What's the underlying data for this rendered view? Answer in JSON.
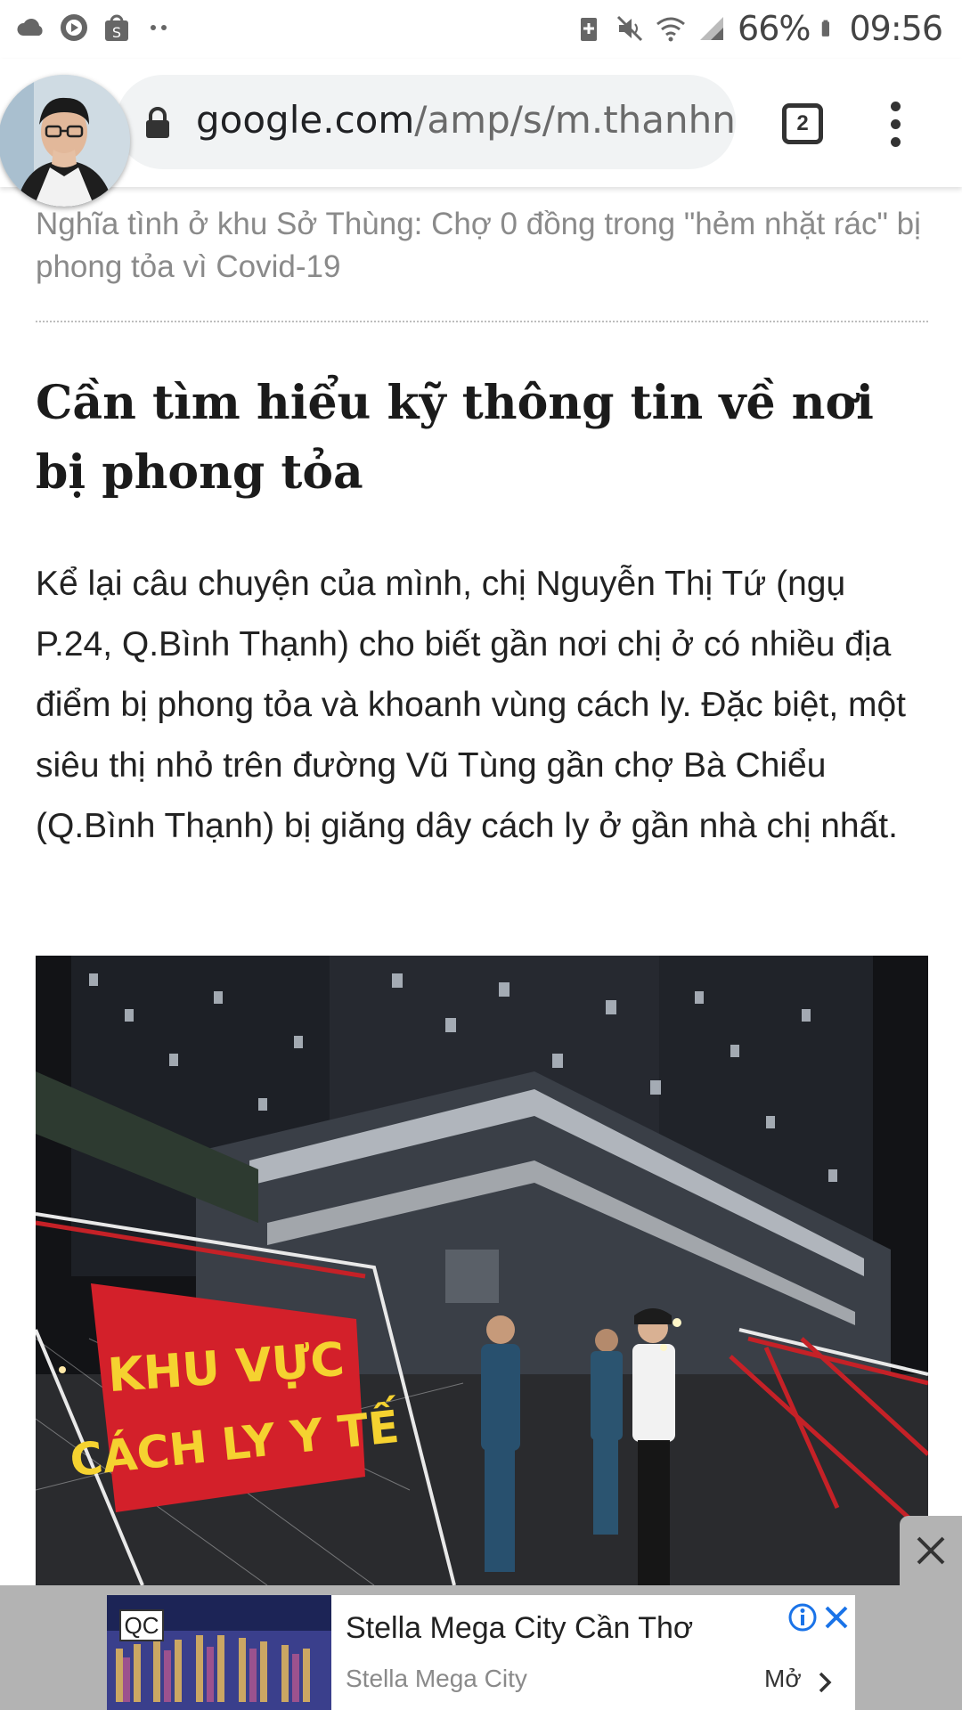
{
  "status_bar": {
    "battery": "66%",
    "time": "09:56",
    "icons_left": [
      "cloud-icon",
      "youtube-music-icon",
      "shopee-icon",
      "more-notifications-icon"
    ],
    "icons_right": [
      "battery-saver-icon",
      "mute-icon",
      "wifi-icon",
      "signal-icon",
      "battery-icon"
    ]
  },
  "browser": {
    "url_host": "google.com",
    "url_path": "/amp/s/m.thanhnien.v",
    "tab_count": "2"
  },
  "article": {
    "related_link": "Nghĩa tình ở khu Sở Thùng: Chợ 0 đồng trong \"hẻm nhặt rác\" bị phong tỏa vì Covid-19",
    "heading": "Cần tìm hiểu kỹ thông tin về nơi bị phong tỏa",
    "paragraph": "Kể lại câu chuyện của mình, chị Nguyễn Thị Tứ (ngụ P.24, Q.Bình Thạnh) cho biết gần nơi chị ở có nhiều địa điểm bị phong tỏa và khoanh vùng cách ly. Đặc biệt, một siêu thị nhỏ trên đường Vũ Tùng gần chợ Bà Chiểu (Q.Bình Thạnh) bị giăng dây cách ly ở gần nhà chị nhất.",
    "photo_banner_line1": "KHU VỰC",
    "photo_banner_line2": "CÁCH LY Y TẾ"
  },
  "ad": {
    "badge": "QC",
    "title": "Stella Mega City Cần Thơ",
    "advertiser": "Stella Mega City",
    "cta": "Mở"
  },
  "colors": {
    "banner_red": "#d3202a",
    "banner_text": "#f5d230",
    "ad_info_blue": "#1a73e8",
    "url_pill": "#f1f3f4"
  }
}
